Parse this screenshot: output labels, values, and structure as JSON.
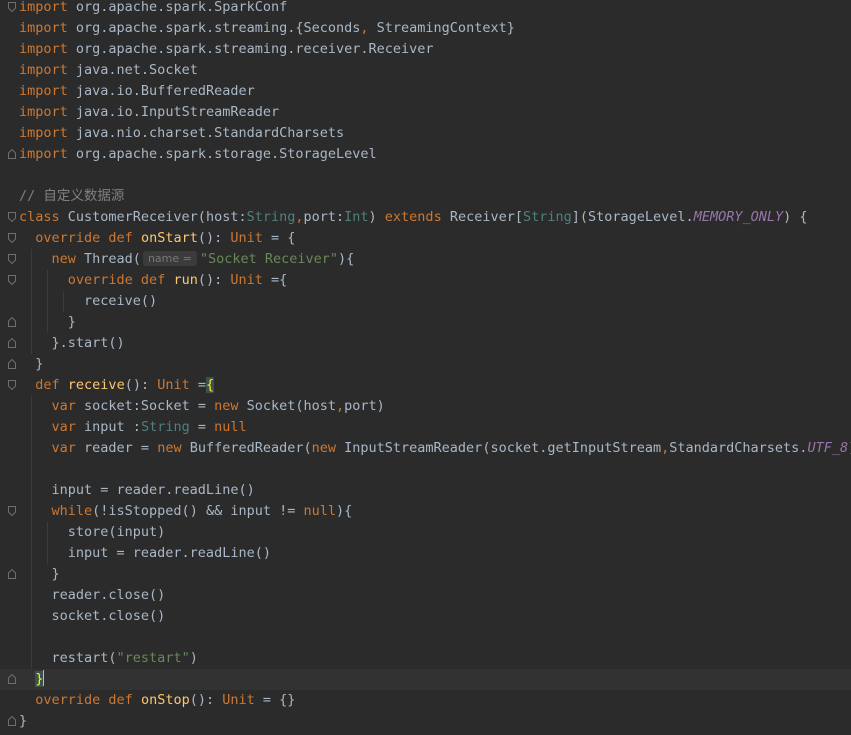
{
  "editor": {
    "colors": {
      "background": "#2b2b2b",
      "current_line": "#323232",
      "keyword": "#cc7832",
      "string": "#6a8759",
      "type": "#4e807d",
      "comment": "#808080",
      "constant": "#9876aa",
      "function": "#ffc66d",
      "plain": "#a9b7c6"
    },
    "lines": [
      {
        "fold": "open",
        "tokens": [
          {
            "t": "import",
            "c": "kw"
          },
          {
            "t": " org.apache.spark.SparkConf"
          }
        ]
      },
      {
        "tokens": [
          {
            "t": "import",
            "c": "kw"
          },
          {
            "t": " org.apache.spark.streaming.{Seconds"
          },
          {
            "t": ",",
            "c": "kw"
          },
          {
            "t": " StreamingContext}"
          }
        ]
      },
      {
        "tokens": [
          {
            "t": "import",
            "c": "kw"
          },
          {
            "t": " org.apache.spark.streaming.receiver.Receiver"
          }
        ]
      },
      {
        "tokens": [
          {
            "t": "import",
            "c": "kw"
          },
          {
            "t": " java.net.Socket"
          }
        ]
      },
      {
        "tokens": [
          {
            "t": "import",
            "c": "kw"
          },
          {
            "t": " java.io.BufferedReader"
          }
        ]
      },
      {
        "tokens": [
          {
            "t": "import",
            "c": "kw"
          },
          {
            "t": " java.io.InputStreamReader"
          }
        ]
      },
      {
        "tokens": [
          {
            "t": "import",
            "c": "kw"
          },
          {
            "t": " java.nio.charset.StandardCharsets"
          }
        ]
      },
      {
        "fold": "close",
        "tokens": [
          {
            "t": "import",
            "c": "kw"
          },
          {
            "t": " org.apache.spark.storage.StorageLevel"
          }
        ]
      },
      {
        "tokens": []
      },
      {
        "tokens": [
          {
            "t": "// 自定义数据源",
            "c": "cmt"
          }
        ]
      },
      {
        "fold": "open",
        "tokens": [
          {
            "t": "class",
            "c": "kw"
          },
          {
            "t": " CustomerReceiver(host:"
          },
          {
            "t": "String",
            "c": "type"
          },
          {
            "t": ",",
            "c": "kw"
          },
          {
            "t": "port:"
          },
          {
            "t": "Int",
            "c": "type"
          },
          {
            "t": ") "
          },
          {
            "t": "extends",
            "c": "kw"
          },
          {
            "t": " Receiver["
          },
          {
            "t": "String",
            "c": "type"
          },
          {
            "t": "](StorageLevel."
          },
          {
            "t": "MEMORY_ONLY",
            "c": "cst"
          },
          {
            "t": ") {"
          }
        ]
      },
      {
        "fold": "open",
        "tokens": [
          {
            "t": "  "
          },
          {
            "t": "override def",
            "c": "kw"
          },
          {
            "t": " "
          },
          {
            "t": "onStart",
            "c": "fn"
          },
          {
            "t": "(): "
          },
          {
            "t": "Unit",
            "c": "kw"
          },
          {
            "t": " = {"
          }
        ]
      },
      {
        "fold": "open",
        "tokens": [
          {
            "t": "    "
          },
          {
            "t": "new",
            "c": "kw"
          },
          {
            "t": " Thread("
          },
          {
            "hint": "name ="
          },
          {
            "t": "\"Socket Receiver\"",
            "c": "str"
          },
          {
            "t": "){"
          }
        ]
      },
      {
        "fold": "open",
        "tokens": [
          {
            "t": "      "
          },
          {
            "t": "override def",
            "c": "kw"
          },
          {
            "t": " "
          },
          {
            "t": "run",
            "c": "fn"
          },
          {
            "t": "(): "
          },
          {
            "t": "Unit",
            "c": "kw"
          },
          {
            "t": " ={"
          }
        ]
      },
      {
        "tokens": [
          {
            "t": "        receive()"
          }
        ]
      },
      {
        "fold": "close",
        "tokens": [
          {
            "t": "      }"
          }
        ]
      },
      {
        "fold": "close",
        "tokens": [
          {
            "t": "    }.start()"
          }
        ]
      },
      {
        "fold": "close",
        "tokens": [
          {
            "t": "  }"
          }
        ]
      },
      {
        "fold": "open",
        "tokens": [
          {
            "t": "  "
          },
          {
            "t": "def",
            "c": "kw"
          },
          {
            "t": " "
          },
          {
            "t": "receive",
            "c": "fn"
          },
          {
            "t": "(): "
          },
          {
            "t": "Unit",
            "c": "kw"
          },
          {
            "t": " ="
          },
          {
            "t": "{",
            "c": "brace-hl"
          }
        ]
      },
      {
        "tokens": [
          {
            "t": "    "
          },
          {
            "t": "var",
            "c": "kw"
          },
          {
            "t": " socket:Socket = "
          },
          {
            "t": "new",
            "c": "kw"
          },
          {
            "t": " Socket(host"
          },
          {
            "t": ",",
            "c": "kw"
          },
          {
            "t": "port)"
          }
        ]
      },
      {
        "tokens": [
          {
            "t": "    "
          },
          {
            "t": "var",
            "c": "kw"
          },
          {
            "t": " input :"
          },
          {
            "t": "String",
            "c": "type"
          },
          {
            "t": " = "
          },
          {
            "t": "null",
            "c": "kw"
          }
        ]
      },
      {
        "tokens": [
          {
            "t": "    "
          },
          {
            "t": "var",
            "c": "kw"
          },
          {
            "t": " reader = "
          },
          {
            "t": "new",
            "c": "kw"
          },
          {
            "t": " BufferedReader("
          },
          {
            "t": "new",
            "c": "kw"
          },
          {
            "t": " InputStreamReader(socket.getInputStream"
          },
          {
            "t": ",",
            "c": "kw"
          },
          {
            "t": "StandardCharsets."
          },
          {
            "t": "UTF_8",
            "c": "cst"
          },
          {
            "t": "))"
          }
        ]
      },
      {
        "tokens": []
      },
      {
        "tokens": [
          {
            "t": "    input = reader.readLine()"
          }
        ]
      },
      {
        "fold": "open",
        "tokens": [
          {
            "t": "    "
          },
          {
            "t": "while",
            "c": "kw"
          },
          {
            "t": "(!isStopped() && input != "
          },
          {
            "t": "null",
            "c": "kw"
          },
          {
            "t": "){"
          }
        ]
      },
      {
        "tokens": [
          {
            "t": "      store(input)"
          }
        ]
      },
      {
        "tokens": [
          {
            "t": "      input = reader.readLine()"
          }
        ]
      },
      {
        "fold": "close",
        "tokens": [
          {
            "t": "    }"
          }
        ]
      },
      {
        "tokens": [
          {
            "t": "    reader.close()"
          }
        ]
      },
      {
        "tokens": [
          {
            "t": "    socket.close()"
          }
        ]
      },
      {
        "tokens": []
      },
      {
        "tokens": [
          {
            "t": "    restart("
          },
          {
            "t": "\"restart\"",
            "c": "str"
          },
          {
            "t": ")"
          }
        ]
      },
      {
        "fold": "close",
        "current": true,
        "tokens": [
          {
            "t": "  "
          },
          {
            "t": "}",
            "c": "brace-hl"
          },
          {
            "caret": true
          }
        ]
      },
      {
        "tokens": [
          {
            "t": "  "
          },
          {
            "t": "override def",
            "c": "kw"
          },
          {
            "t": " "
          },
          {
            "t": "onStop",
            "c": "fn"
          },
          {
            "t": "(): "
          },
          {
            "t": "Unit",
            "c": "kw"
          },
          {
            "t": " = {}"
          }
        ]
      },
      {
        "fold": "close",
        "tokens": [
          {
            "t": "}"
          }
        ]
      }
    ]
  }
}
